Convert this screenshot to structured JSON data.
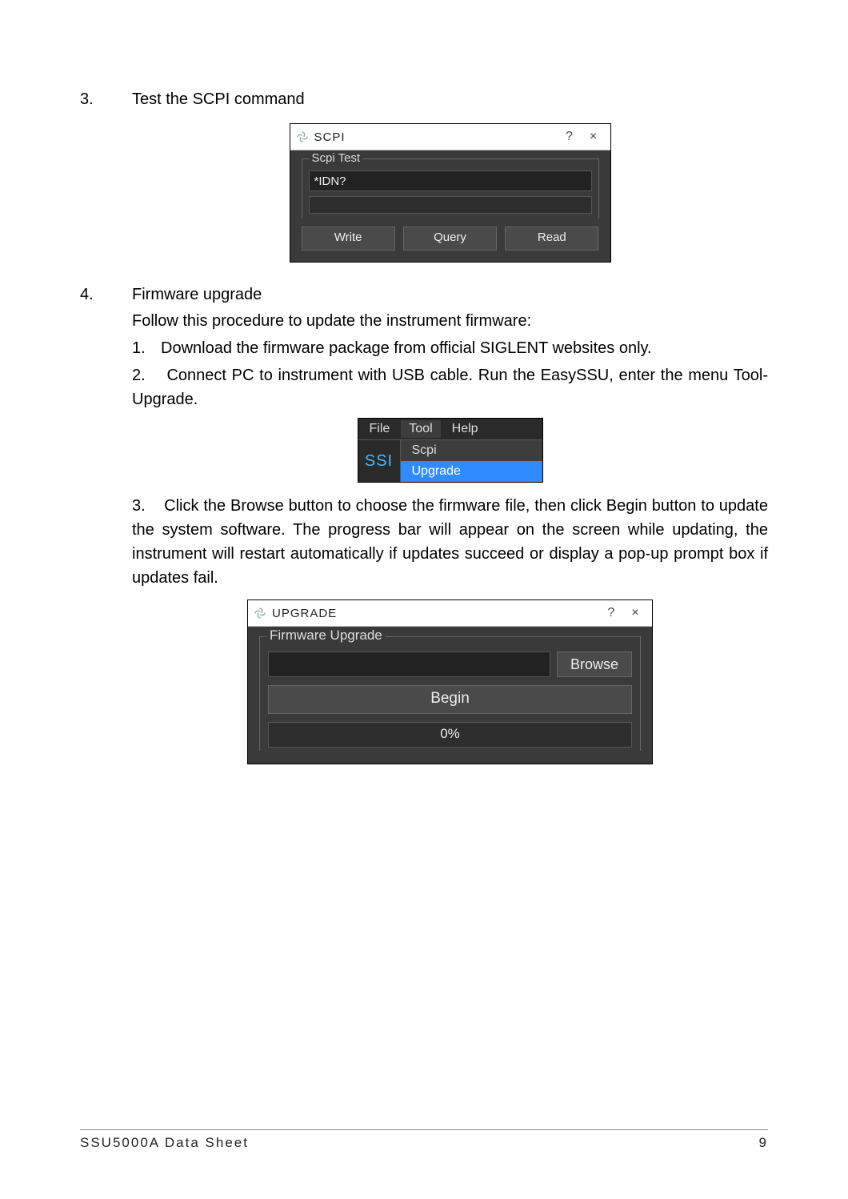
{
  "step3": {
    "number": "3.",
    "title": "Test the SCPI command"
  },
  "scpi_dialog": {
    "title": "SCPI",
    "help": "?",
    "close": "×",
    "group_label": "Scpi Test",
    "input_value": "*IDN?",
    "btn_write": "Write",
    "btn_query": "Query",
    "btn_read": "Read"
  },
  "step4": {
    "number": "4.",
    "title": "Firmware upgrade",
    "intro": "Follow this procedure to update the instrument firmware:",
    "sub1_num": "1.",
    "sub1": "Download the firmware package from official SIGLENT websites only.",
    "sub2_num": "2.",
    "sub2": "Connect PC to instrument with USB cable. Run the EasySSU, enter the menu Tool-Upgrade.",
    "sub3_num": "3.",
    "sub3": "Click the Browse button to choose the firmware file, then click Begin button to update the system software. The progress bar will appear on the screen while updating, the instrument will restart automatically if updates succeed or display a pop-up prompt box if updates fail."
  },
  "menu": {
    "file": "File",
    "tool": "Tool",
    "help": "Help",
    "left": "SSI",
    "item_scpi": "Scpi",
    "item_upgrade": "Upgrade"
  },
  "upgrade_dialog": {
    "title": "UPGRADE",
    "help": "?",
    "close": "×",
    "group_label": "Firmware Upgrade",
    "browse": "Browse",
    "begin": "Begin",
    "progress": "0%"
  },
  "footer": {
    "left": "SSU5000A Data Sheet",
    "right": "9"
  }
}
